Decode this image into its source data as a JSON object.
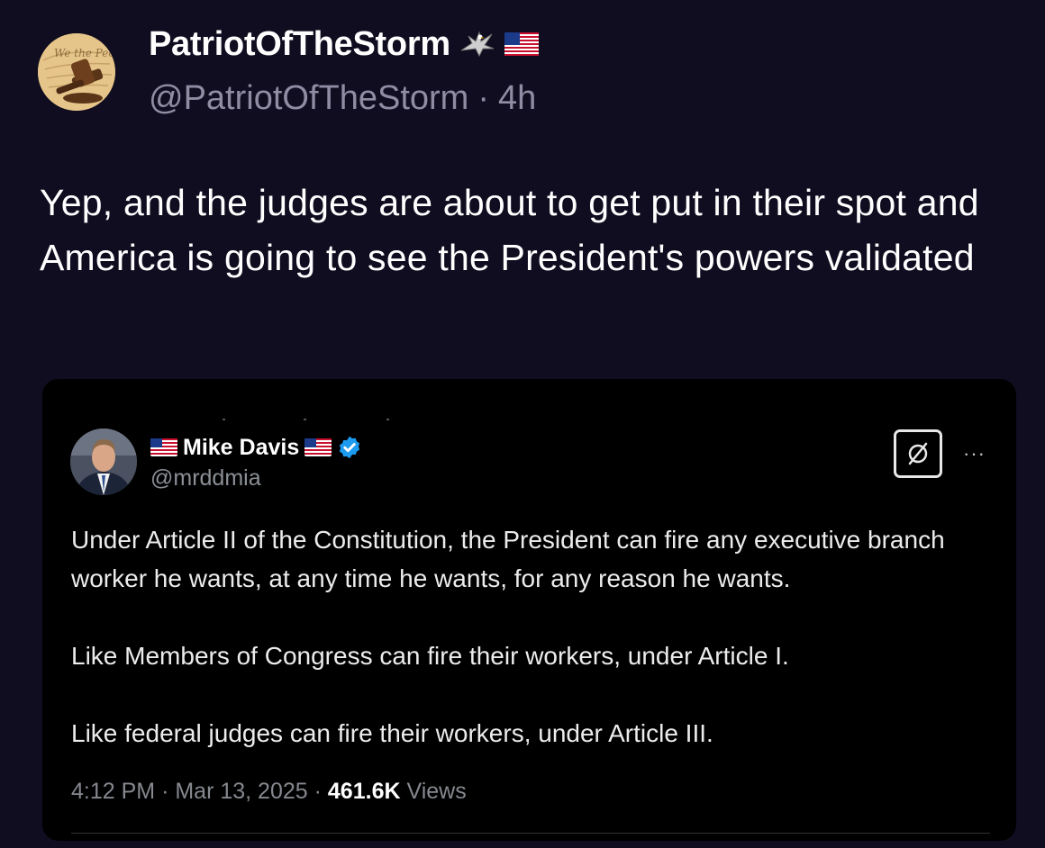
{
  "post": {
    "display_name": "PatriotOfTheStorm",
    "handle": "@PatriotOfTheStorm",
    "separator": "·",
    "time_ago": "4h",
    "text": "Yep, and the judges are about to get put in their spot and America is going to see the President's powers validated",
    "name_icons": [
      "eagle-icon",
      "us-flag-icon"
    ]
  },
  "quoted_post": {
    "display_name": "Mike Davis",
    "handle": "@mrddmia",
    "verified": true,
    "paragraphs": [
      "Under Article II of the Constitution, the President can fire any executive branch worker he wants, at any time he wants, for any reason he wants.",
      "Like Members of Congress can fire their workers, under Article I.",
      "Like federal judges can fire their workers, under Article III."
    ],
    "time": "4:12 PM",
    "meta_sep": "·",
    "date": "Mar 13, 2025",
    "views_count": "461.6K",
    "views_label": "Views",
    "more_label": "···",
    "verified_color": "#1d9bf0"
  }
}
